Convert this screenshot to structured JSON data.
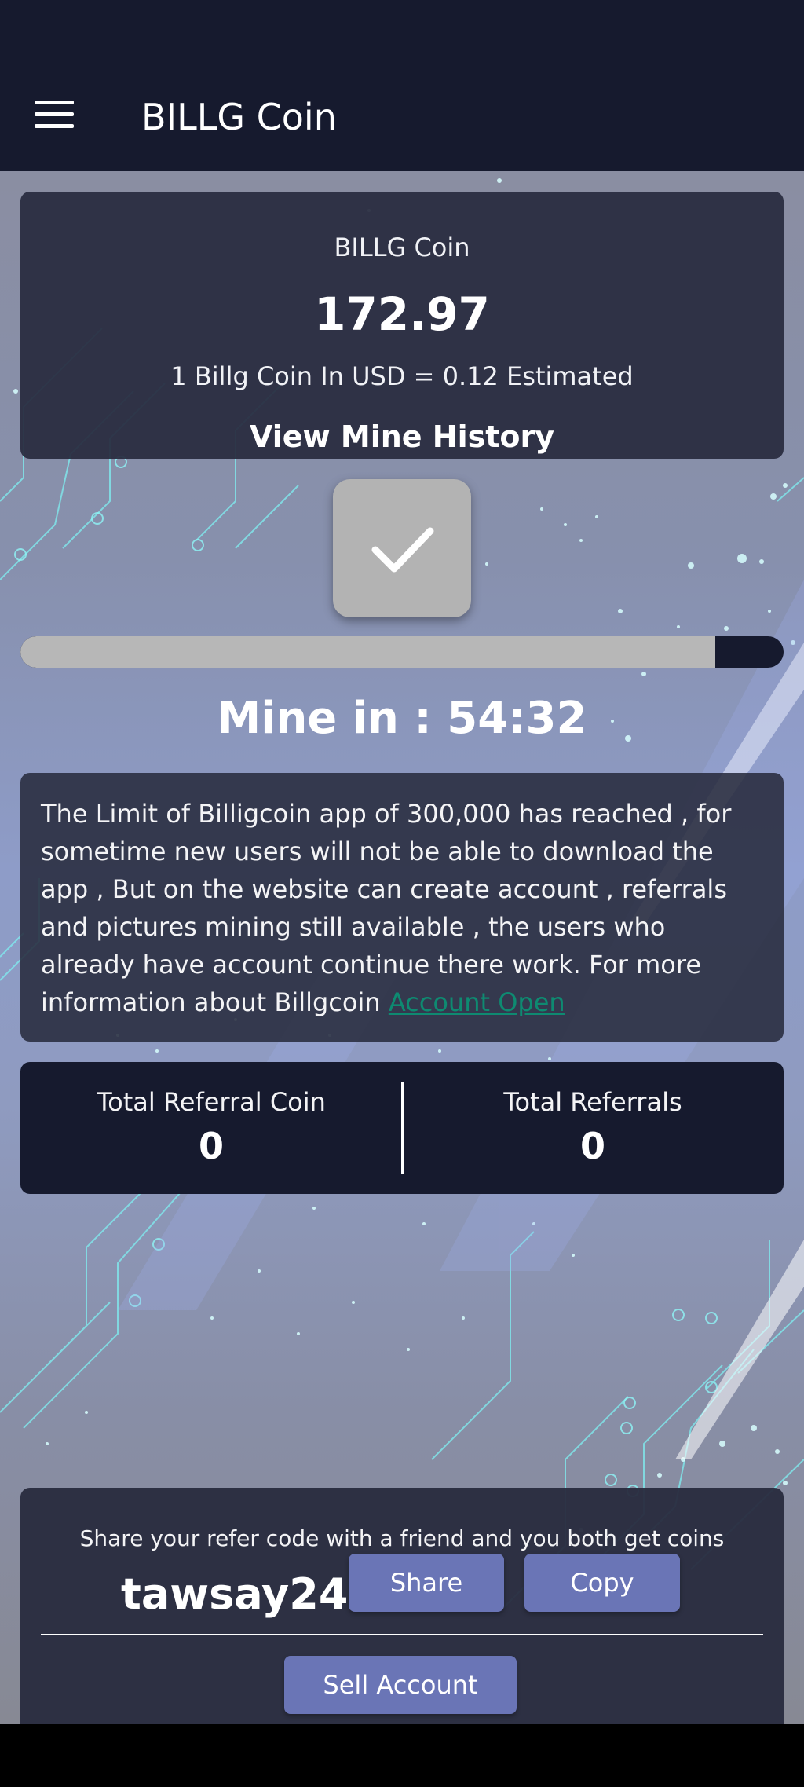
{
  "app_bar": {
    "title": "BILLG Coin"
  },
  "coin_card": {
    "label": "BILLG Coin",
    "balance": "172.97",
    "rate_text": "1 Billg Coin In USD = 0.12 Estimated",
    "history_link": "View Mine History"
  },
  "mining": {
    "button_icon": "checkmark-icon",
    "progress_fraction": 0.91,
    "timer_text": "Mine in : 54:32"
  },
  "notice": {
    "text": "The Limit of Billigcoin app of 300,000 has reached , for sometime new users will not be able to download the app , But on the website can create account , referrals and pictures mining still available , the users who already have account continue there work. For more information about Billgcoin ",
    "link_text": "Account Open"
  },
  "stats": {
    "referral_coin_label": "Total Referral Coin",
    "referral_coin_value": "0",
    "referrals_label": "Total Referrals",
    "referrals_value": "0"
  },
  "refer": {
    "note": "Share your refer code with a friend and you both get coins",
    "code": "tawsay24",
    "share_label": "Share",
    "copy_label": "Copy",
    "sell_label": "Sell Account"
  },
  "colors": {
    "app_bar": "#161a2e",
    "card": "#282b3e",
    "button": "#6a75b6",
    "link": "#0e8a71"
  }
}
